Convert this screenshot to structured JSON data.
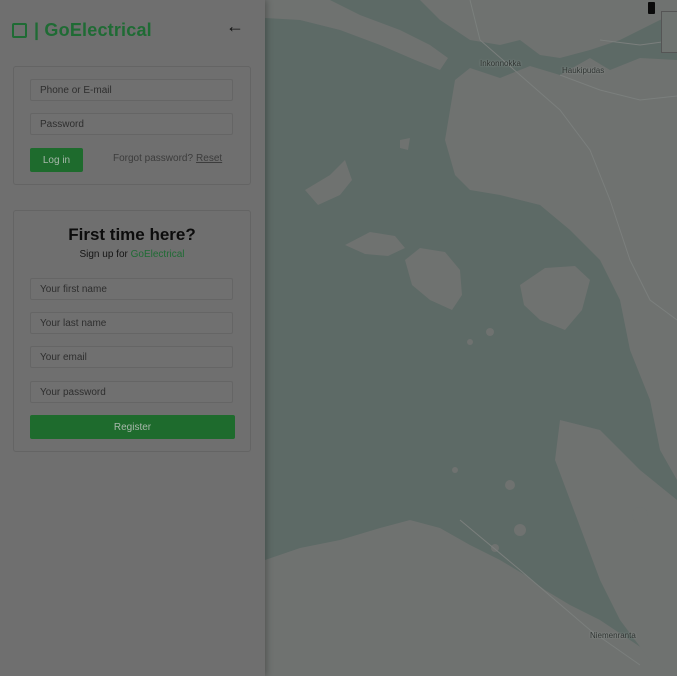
{
  "map": {
    "labels": [
      "Inkonnokka",
      "Haukipudas",
      "Niemenranta"
    ]
  },
  "header": {
    "brand": "| GoElectrical",
    "back_icon": "←"
  },
  "login": {
    "phone_placeholder": "Phone or E-mail",
    "password_placeholder": "Password",
    "login_button": "Log in",
    "forgot_text": "Forgot password?",
    "reset_link": "Reset"
  },
  "signup": {
    "title": "First time here?",
    "subtitle_prefix": "Sign up for ",
    "subtitle_brand": "GoElectrical",
    "first_name_placeholder": "Your first name",
    "last_name_placeholder": "Your last name",
    "email_placeholder": "Your email",
    "password_placeholder": "Your password",
    "register_button": "Register"
  },
  "colors": {
    "brand_green": "#1f6b34",
    "button_green": "#1e6b2d",
    "map_water": "#5d6a66",
    "map_land": "#6f7270"
  }
}
